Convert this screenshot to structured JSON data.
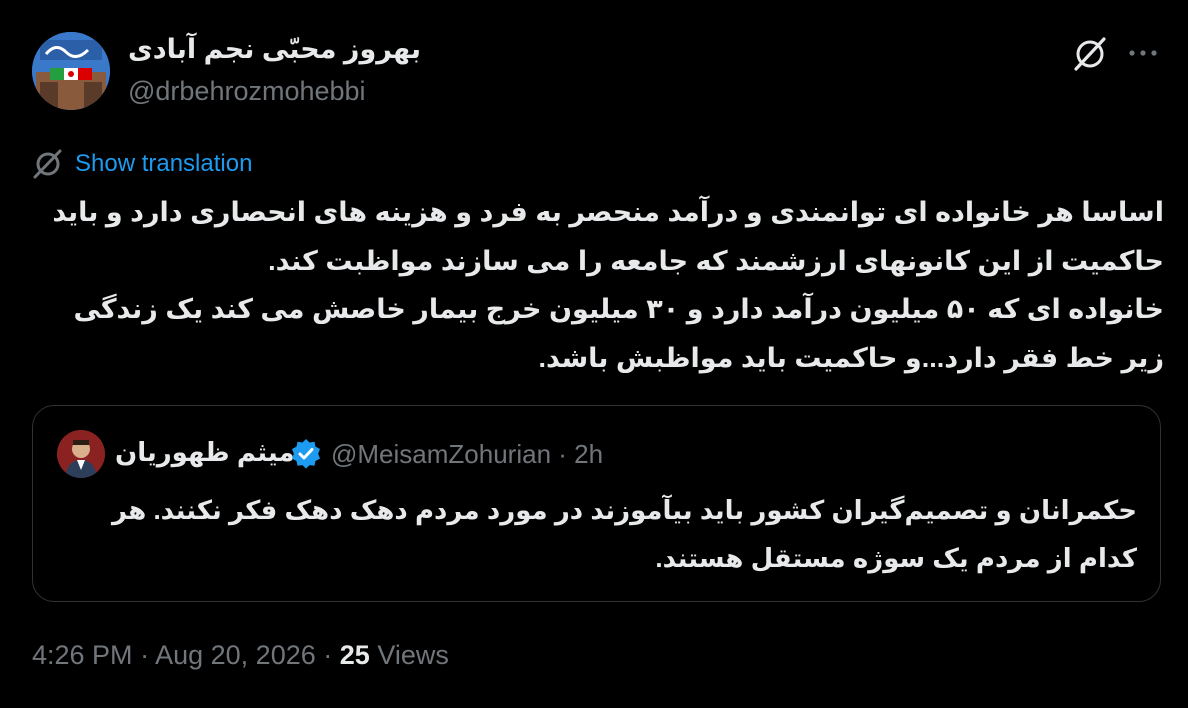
{
  "author": {
    "display_name": "بهروز محبّی نجم آبادی",
    "handle": "@drbehrozmohebbi",
    "avatar_icon": "profile-photo"
  },
  "actions": {
    "grok_icon": "grok-icon",
    "more_icon": "more-icon",
    "more_label": "···"
  },
  "translation": {
    "label": "Show translation",
    "icon": "translate-icon"
  },
  "tweet": {
    "text": "اساسا هر خانواده ای توانمندی و درآمد منحصر به فرد و هزینه های انحصاری دارد و باید حاکمیت از این کانونهای ارزشمند که جامعه را می سازند مواظبت کند.\nخانواده ای که ۵۰ میلیون درآمد دارد و ۳۰ میلیون خرج بیمار خاصش می کند یک زندگی زیر خط فقر دارد...و حاکمیت باید مواظبش باشد."
  },
  "quote": {
    "display_name": "میثم ظهوریان",
    "handle": "@MeisamZohurian",
    "separator": "·",
    "time": "2h",
    "verified_icon": "verified-badge-icon",
    "text": "حکمرانان و تصمیم‌گیران کشور باید بیآموزند در مورد مردم دهک دهک فکر نکنند. هر کدام از مردم یک سوژه مستقل هستند."
  },
  "footer": {
    "time": "4:26 PM",
    "dot1": "·",
    "date": "Aug 20, 2026",
    "dot2": "·",
    "views_count": "25",
    "views_label": "Views"
  },
  "colors": {
    "background": "#000000",
    "text": "#e7e9ea",
    "muted": "#71767b",
    "link": "#1d9bf0",
    "border": "#2f3336"
  }
}
